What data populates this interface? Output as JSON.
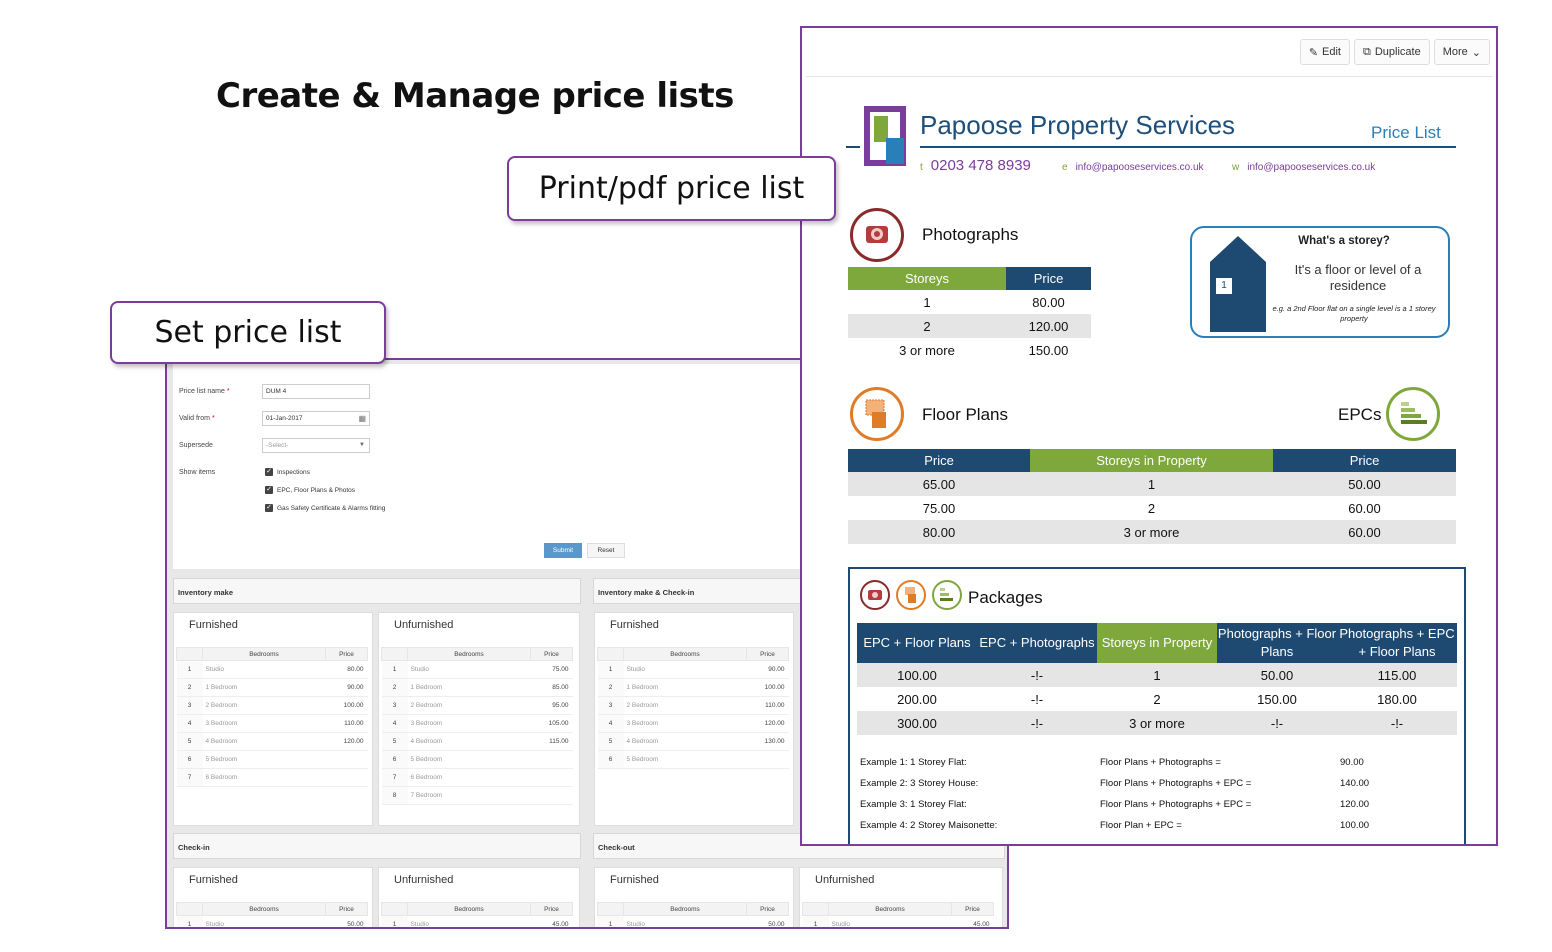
{
  "slide": {
    "title": "Create & Manage price lists",
    "callout_print": "Print/pdf price list",
    "callout_set": "Set price list"
  },
  "form": {
    "name_label": "Price list name",
    "name_value": "DUM 4",
    "valid_label": "Valid from",
    "valid_value": "01-Jan-2017",
    "supersede_label": "Supersede",
    "supersede_value": "-Select-",
    "show_items_label": "Show items",
    "checkboxes": [
      "Inspections",
      "EPC, Floor Plans & Photos",
      "Gas Safety Certificate & Alarms fitting"
    ],
    "submit": "Submit",
    "reset": "Reset",
    "required_mark": "*"
  },
  "sections": {
    "inventory_make": "Inventory make",
    "inventory_checkin": "Inventory make & Check-in",
    "checkin": "Check-in",
    "checkout": "Check-out"
  },
  "tables": {
    "furnished": "Furnished",
    "unfurnished": "Unfurnished",
    "col_bedrooms": "Bedrooms",
    "col_price": "Price",
    "inv_furnished": [
      [
        "1",
        "Studio",
        "80.00"
      ],
      [
        "2",
        "1 Bedroom",
        "90.00"
      ],
      [
        "3",
        "2 Bedroom",
        "100.00"
      ],
      [
        "4",
        "3 Bedroom",
        "110.00"
      ],
      [
        "5",
        "4 Bedroom",
        "120.00"
      ],
      [
        "6",
        "5 Bedroom",
        ""
      ],
      [
        "7",
        "6 Bedroom",
        ""
      ]
    ],
    "inv_unfurnished": [
      [
        "1",
        "Studio",
        "75.00"
      ],
      [
        "2",
        "1 Bedroom",
        "85.00"
      ],
      [
        "3",
        "2 Bedroom",
        "95.00"
      ],
      [
        "4",
        "3 Bedroom",
        "105.00"
      ],
      [
        "5",
        "4 Bedroom",
        "115.00"
      ],
      [
        "6",
        "5 Bedroom",
        ""
      ],
      [
        "7",
        "6 Bedroom",
        ""
      ],
      [
        "8",
        "7 Bedroom",
        ""
      ]
    ],
    "invci_furnished": [
      [
        "1",
        "Studio",
        "90.00"
      ],
      [
        "2",
        "1 Bedroom",
        "100.00"
      ],
      [
        "3",
        "2 Bedroom",
        "110.00"
      ],
      [
        "4",
        "3 Bedroom",
        "120.00"
      ],
      [
        "5",
        "4 Bedroom",
        "130.00"
      ],
      [
        "6",
        "5 Bedroom",
        ""
      ]
    ],
    "ci_furnished": [
      [
        "1",
        "Studio",
        "50.00"
      ]
    ],
    "ci_unfurnished": [
      [
        "1",
        "Studio",
        "45.00"
      ]
    ],
    "co_furnished": [
      [
        "1",
        "Studio",
        "50.00"
      ]
    ],
    "co_unfurnished": [
      [
        "1",
        "Studio",
        "45.00"
      ]
    ]
  },
  "toolbar": {
    "edit": "Edit",
    "duplicate": "Duplicate",
    "more": "More"
  },
  "doc": {
    "company": "Papoose Property Services",
    "price_list": "Price List",
    "phone_key": "t",
    "phone": "0203 478 8939",
    "email_key": "e",
    "email": "info@papooseservices.co.uk",
    "web_key": "w",
    "web": "info@papooseservices.co.uk",
    "photographs": "Photographs",
    "photo_head": [
      "Storeys",
      "Price"
    ],
    "photo_rows": [
      [
        "1",
        "80.00"
      ],
      [
        "2",
        "120.00"
      ],
      [
        "3 or more",
        "150.00"
      ]
    ],
    "storey_title": "What's a storey?",
    "storey_text": "It's a floor or level of a residence",
    "storey_note": "e.g. a 2nd Floor flat on a single level  is a 1 storey property",
    "house_number": "1",
    "floor_plans": "Floor Plans",
    "epcs": "EPCs",
    "fp_head": [
      "Price",
      "Storeys in Property",
      "Price"
    ],
    "fp_rows": [
      [
        "65.00",
        "1",
        "50.00"
      ],
      [
        "75.00",
        "2",
        "60.00"
      ],
      [
        "80.00",
        "3 or more",
        "60.00"
      ]
    ],
    "packages": "Packages",
    "pk_head": [
      "EPC + Floor Plans",
      "EPC + Photographs",
      "Storeys in Property",
      "Photographs + Floor Plans",
      "Photographs + EPC + Floor Plans"
    ],
    "pk_rows": [
      [
        "100.00",
        "-!-",
        "1",
        "50.00",
        "115.00"
      ],
      [
        "200.00",
        "-!-",
        "2",
        "150.00",
        "180.00"
      ],
      [
        "300.00",
        "-!-",
        "3 or more",
        "-!-",
        "-!-"
      ]
    ],
    "examples": [
      [
        "Example 1: 1 Storey Flat:",
        "Floor Plans + Photographs =",
        "90.00"
      ],
      [
        "Example 2: 3 Storey House:",
        "Floor Plans + Photographs + EPC =",
        "140.00"
      ],
      [
        "Example 3: 1 Storey Flat:",
        "Floor Plans + Photographs + EPC =",
        "120.00"
      ],
      [
        "Example 4: 2 Storey Maisonette:",
        "Floor Plan + EPC =",
        "100.00"
      ]
    ]
  },
  "colors": {
    "purple": "#7a3d9a",
    "navy": "#1e4a72",
    "green": "#7ea83b",
    "blue": "#2b7fb8",
    "orange": "#e07b26"
  }
}
